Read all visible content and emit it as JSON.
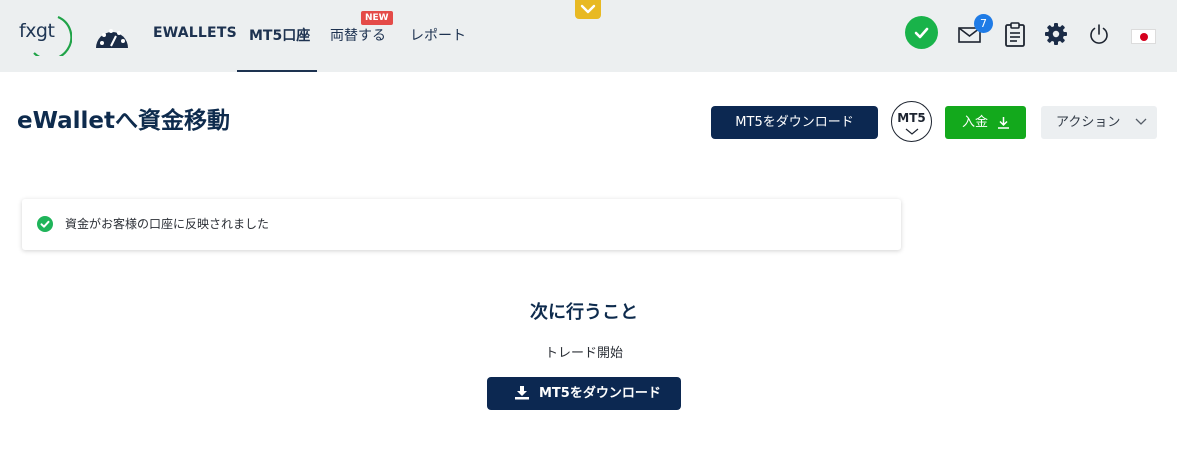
{
  "nav": {
    "logo_text": "fxgt",
    "links": [
      {
        "label": "EWALLETS"
      },
      {
        "label": "MT5口座"
      },
      {
        "label": "両替する",
        "badge": "NEW"
      },
      {
        "label": "レポート"
      }
    ],
    "active_link": "MT5口座",
    "mail_count": "7",
    "icons": [
      "dashboard-icon",
      "verified-check-icon",
      "mail-icon",
      "clipboard-icon",
      "gear-icon",
      "power-icon",
      "japan-flag-icon",
      "chevron-down-icon"
    ],
    "accent_colors": {
      "nav_bg": "#eceff0",
      "check": "#19b34a",
      "badge": "#1e7be6",
      "new": "#e44b48",
      "collapse_tab": "#e8b923"
    }
  },
  "header": {
    "title": "eWalletへ資金移動",
    "download_button": "MT5をダウンロード",
    "platform_badge": "MT5",
    "deposit_button": "入金",
    "action_button": "アクション",
    "colors": {
      "primary": "#0c2851",
      "deposit": "#13a91c",
      "action": "#eceff1"
    }
  },
  "alert": {
    "message": "資金がお客様の口座に反映されました",
    "type": "success"
  },
  "next_steps": {
    "title": "次に行うこと",
    "subtitle": "トレード開始",
    "button": "MT5をダウンロード"
  }
}
